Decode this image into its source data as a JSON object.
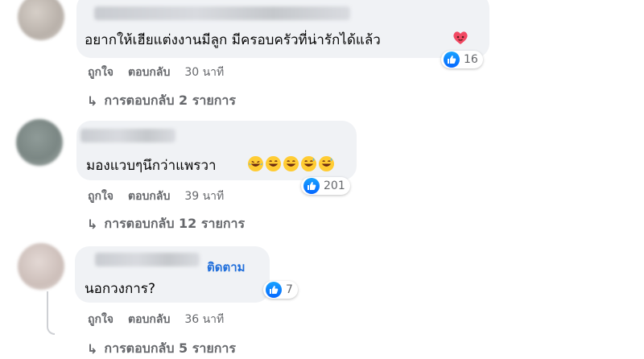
{
  "comments": [
    {
      "text": "อยากให้เฮียแต่งงานมีลูก มีครอบครัวที่น่ารักได้แล้ว",
      "emoji": "heart-face-emoji",
      "reaction_count": "16",
      "like_label": "ถูกใจ",
      "reply_label": "ตอบกลับ",
      "time": "30 นาที",
      "replies_label": "การตอบกลับ 2 รายการ"
    },
    {
      "text": "มองแวบๆนึกว่าแพรวา",
      "emoji": "laughing-emoji-x5",
      "reaction_count": "201",
      "like_label": "ถูกใจ",
      "reply_label": "ตอบกลับ",
      "time": "39 นาที",
      "replies_label": "การตอบกลับ 12 รายการ"
    },
    {
      "follow_label": "ติดตาม",
      "text": "นอกวงการ?",
      "reaction_count": "7",
      "like_label": "ถูกใจ",
      "reply_label": "ตอบกลับ",
      "time": "36 นาที",
      "replies_label": "การตอบกลับ 5 รายการ"
    }
  ],
  "colors": {
    "bubble": "#f0f2f5",
    "link_blue": "#216fdb",
    "meta_gray": "#65676b",
    "like_blue": "#0566ff"
  }
}
